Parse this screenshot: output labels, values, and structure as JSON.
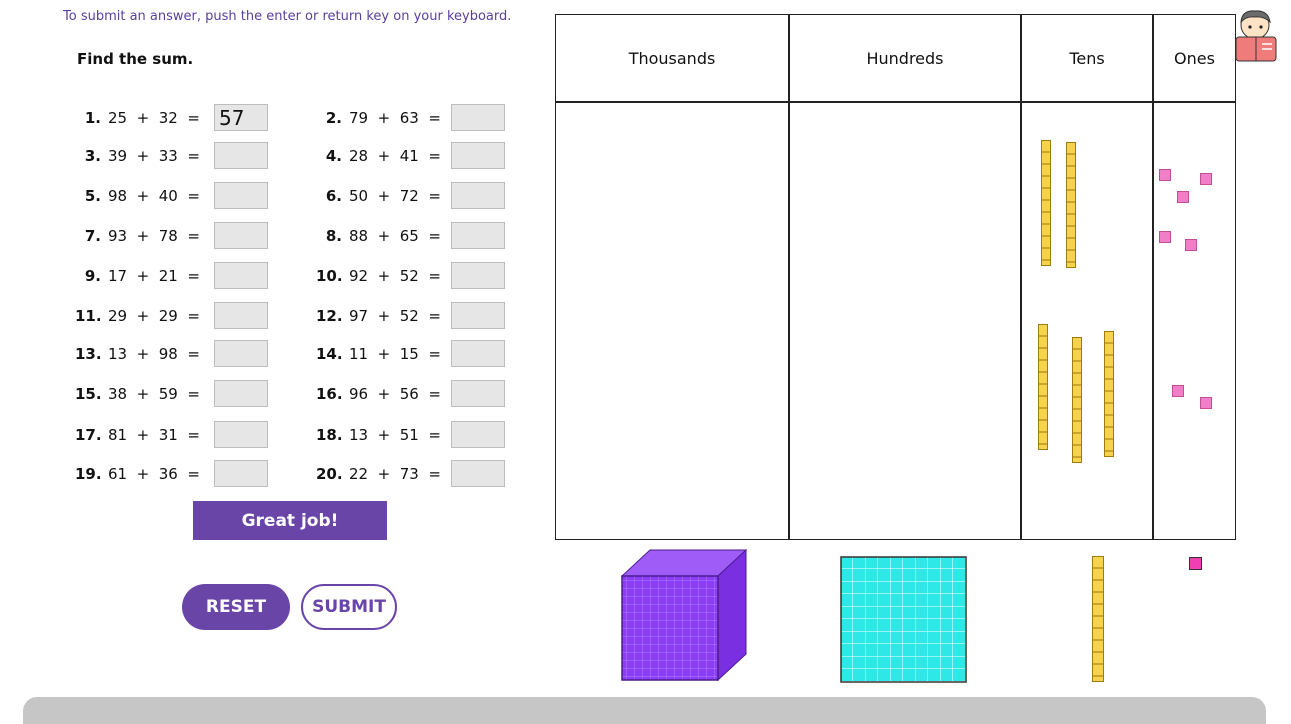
{
  "instruction": "To submit an answer, push the enter or return key on your keyboard.",
  "heading": "Find the sum.",
  "problems": [
    {
      "num": "1.",
      "eq": "25  +  32  =",
      "value": "57"
    },
    {
      "num": "2.",
      "eq": "79  +  63  =",
      "value": ""
    },
    {
      "num": "3.",
      "eq": "39  +  33  =",
      "value": ""
    },
    {
      "num": "4.",
      "eq": "28  +  41  =",
      "value": ""
    },
    {
      "num": "5.",
      "eq": "98  +  40  =",
      "value": ""
    },
    {
      "num": "6.",
      "eq": "50  +  72  =",
      "value": ""
    },
    {
      "num": "7.",
      "eq": "93  +  78  =",
      "value": ""
    },
    {
      "num": "8.",
      "eq": "88  +  65  =",
      "value": ""
    },
    {
      "num": "9.",
      "eq": "17  +  21  =",
      "value": ""
    },
    {
      "num": "10.",
      "eq": "92  +  52  =",
      "value": ""
    },
    {
      "num": "11.",
      "eq": "29  +  29  =",
      "value": ""
    },
    {
      "num": "12.",
      "eq": "97  +  52  =",
      "value": ""
    },
    {
      "num": "13.",
      "eq": "13  +  98  =",
      "value": ""
    },
    {
      "num": "14.",
      "eq": "11  +  15  =",
      "value": ""
    },
    {
      "num": "15.",
      "eq": "38  +  59  =",
      "value": ""
    },
    {
      "num": "16.",
      "eq": "96  +  56  =",
      "value": ""
    },
    {
      "num": "17.",
      "eq": "81  +  31  =",
      "value": ""
    },
    {
      "num": "18.",
      "eq": "13  +  51  =",
      "value": ""
    },
    {
      "num": "19.",
      "eq": "61  +  36  =",
      "value": ""
    },
    {
      "num": "20.",
      "eq": "22  +  73  =",
      "value": ""
    }
  ],
  "feedback": "Great job!",
  "buttons": {
    "reset": "RESET",
    "submit": "SUBMIT"
  },
  "place_value": {
    "columns": [
      "Thousands",
      "Hundreds",
      "Tens",
      "Ones"
    ]
  },
  "colors": {
    "accent": "#6a45a8",
    "rod": "#f5d34c",
    "unit": "#f07fc8",
    "flat": "#2ee8e8",
    "cube": "#8a3df2"
  }
}
